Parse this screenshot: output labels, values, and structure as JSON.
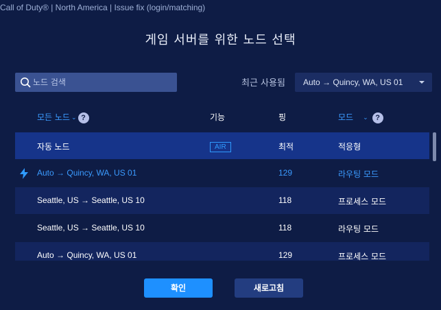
{
  "window": {
    "title": "Call of Duty® | North America | Issue fix (login/matching)"
  },
  "heading": "게임 서버를 위한 노드 선택",
  "search": {
    "placeholder": "노드 검색"
  },
  "recent": {
    "label": "최근 사용됨",
    "selected": "Auto → Quincy, WA, US 01"
  },
  "columns": {
    "node": "모든 노드",
    "feature": "기능",
    "ping": "핑",
    "mode": "모드"
  },
  "rows": [
    {
      "node": "자동 노드",
      "feature": "AIR",
      "ping": "최적",
      "mode": "적응형"
    },
    {
      "node": "Auto → Quincy, WA, US 01",
      "feature": "",
      "ping": "129",
      "mode": "라우팅 모드"
    },
    {
      "node": "Seattle, US → Seattle, US 10",
      "feature": "",
      "ping": "118",
      "mode": "프로세스 모드"
    },
    {
      "node": "Seattle, US → Seattle, US 10",
      "feature": "",
      "ping": "118",
      "mode": "라우팅 모드"
    },
    {
      "node": "Auto → Quincy, WA, US 01",
      "feature": "",
      "ping": "129",
      "mode": "프로세스 모드"
    }
  ],
  "buttons": {
    "confirm": "확인",
    "refresh": "새로고침"
  },
  "colors": {
    "background": "#0e1c45",
    "accent": "#2f9bff",
    "selected_row": "#16348a",
    "confirm": "#1e90ff"
  }
}
